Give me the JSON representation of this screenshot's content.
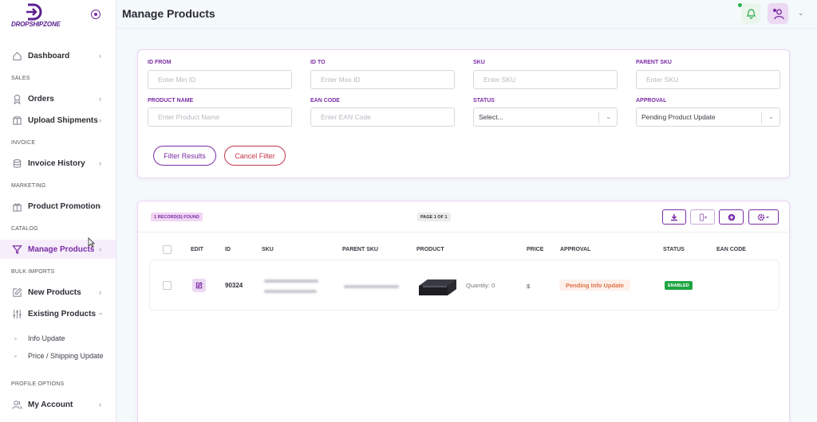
{
  "brand": {
    "name": "DROPSHIPZONE"
  },
  "header": {
    "title": "Manage Products"
  },
  "sidebar": {
    "items": [
      {
        "label": "Dashboard"
      },
      {
        "section": "SALES"
      },
      {
        "label": "Orders"
      },
      {
        "label": "Upload Shipments"
      },
      {
        "section": "INVOICE"
      },
      {
        "label": "Invoice History"
      },
      {
        "section": "MARKETING"
      },
      {
        "label": "Product Promotion"
      },
      {
        "section": "CATALOG"
      },
      {
        "label": "Manage Products"
      },
      {
        "section": "BULK IMPORTS"
      },
      {
        "label": "New Products"
      },
      {
        "label": "Existing Products"
      },
      {
        "label": "Info Update"
      },
      {
        "label": "Price / Shipping Update"
      },
      {
        "section": "PROFILE OPTIONS"
      },
      {
        "label": "My Account"
      }
    ]
  },
  "filters": {
    "id_from": {
      "label": "ID FROM",
      "placeholder": "Enter Min ID"
    },
    "id_to": {
      "label": "ID TO",
      "placeholder": "Enter Max ID"
    },
    "sku": {
      "label": "SKU",
      "placeholder": "Enter SKU"
    },
    "parent_sku": {
      "label": "PARENT SKU",
      "placeholder": "Enter SKU"
    },
    "product_name": {
      "label": "PRODUCT NAME",
      "placeholder": "Enter Product Name"
    },
    "ean_code": {
      "label": "EAN CODE",
      "placeholder": "Enter EAN Code"
    },
    "status": {
      "label": "STATUS",
      "value": "Select..."
    },
    "approval": {
      "label": "APPROVAL",
      "value": "Pending Product Update"
    },
    "filter_button": "Filter Results",
    "cancel_button": "Cancel Filter"
  },
  "table": {
    "records_found": "1 RECORD(S) FOUND",
    "page_info": "PAGE 1 OF 1",
    "columns": {
      "edit": "EDIT",
      "id": "ID",
      "sku": "SKU",
      "parent_sku": "PARENT SKU",
      "product": "PRODUCT",
      "price": "PRICE",
      "approval": "APPROVAL",
      "status": "STATUS",
      "ean_code": "EAN CODE"
    },
    "rows": [
      {
        "id": "90324",
        "quantity": "Quantity: 0",
        "price": "$",
        "approval": "Pending Info Update",
        "status": "ENABLED"
      }
    ]
  },
  "colors": {
    "accent": "#7b2ca5",
    "danger": "#c0354a",
    "success": "#1fa543",
    "pending": "#e0724a"
  }
}
